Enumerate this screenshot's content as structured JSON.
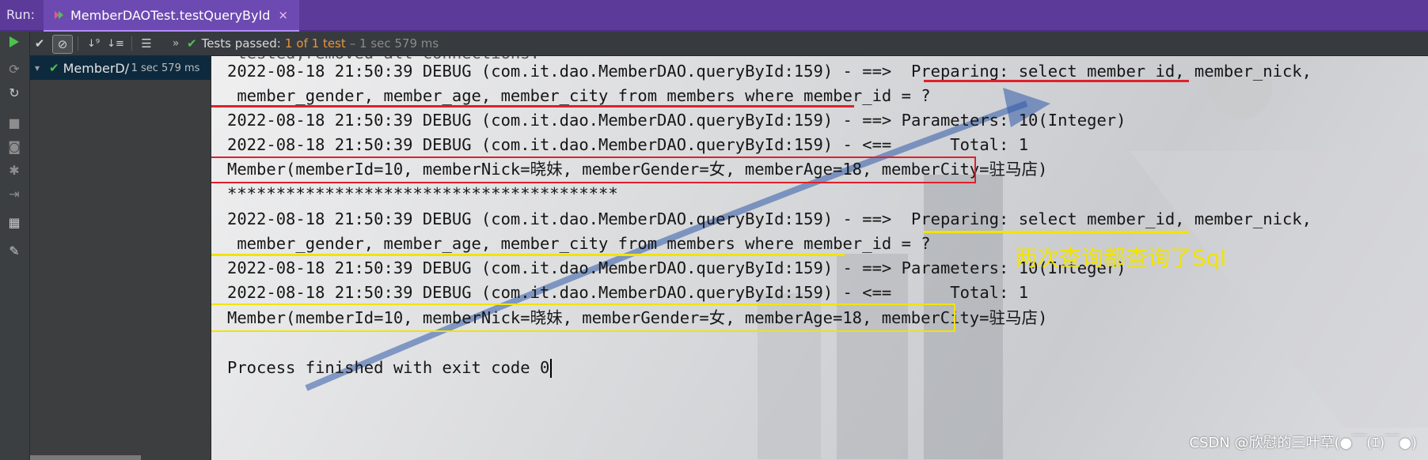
{
  "titlebar": {
    "run_label": "Run:",
    "tab_label": "MemberDAOTest.testQueryById",
    "tab_close": "×"
  },
  "toolbar": {
    "status_prefix": "Tests passed:",
    "status_count": "1",
    "status_total": "of 1 test",
    "status_time": "– 1 sec 579 ms",
    "more": "»"
  },
  "tree": {
    "item_name": "MemberD/",
    "item_time": "1 sec 579 ms"
  },
  "console": {
    "lines": [
      " tested,removed all connections.",
      "2022-08-18 21:50:39 DEBUG (com.it.dao.MemberDAO.queryById:159) - ==>  Preparing: select member_id, member_nick,",
      " member_gender, member_age, member_city from members where member_id = ?",
      "2022-08-18 21:50:39 DEBUG (com.it.dao.MemberDAO.queryById:159) - ==> Parameters: 10(Integer)",
      "2022-08-18 21:50:39 DEBUG (com.it.dao.MemberDAO.queryById:159) - <==      Total: 1",
      "Member(memberId=10, memberNick=晓妹, memberGender=女, memberAge=18, memberCity=驻马店)",
      "****************************************",
      "2022-08-18 21:50:39 DEBUG (com.it.dao.MemberDAO.queryById:159) - ==>  Preparing: select member_id, member_nick,",
      " member_gender, member_age, member_city from members where member_id = ?",
      "2022-08-18 21:50:39 DEBUG (com.it.dao.MemberDAO.queryById:159) - ==> Parameters: 10(Integer)",
      "2022-08-18 21:50:39 DEBUG (com.it.dao.MemberDAO.queryById:159) - <==      Total: 1",
      "Member(memberId=10, memberNick=晓妹, memberGender=女, memberAge=18, memberCity=驻马店)",
      "",
      "Process finished with exit code 0"
    ],
    "annotation": "两次查询都查询了Sql",
    "watermark": "CSDN @欣慰的三叶草(●￣(ｴ)￣●)"
  },
  "colors": {
    "titlebar": "#5b3a9a",
    "pass_green": "#4ec24e",
    "highlight_red": "#e0202a",
    "highlight_yellow": "#f2e400",
    "status_orange": "#e6973c"
  },
  "icons": {
    "gutter": [
      "run-icon",
      "rerun-failed-icon",
      "toggle-auto-test-icon",
      "stop-icon",
      "camera-icon",
      "settings-icon",
      "exit-icon",
      "layout-icon",
      "pin-icon"
    ],
    "toolbar": [
      "show-passed-icon",
      "show-ignored-icon",
      "sort-alpha-icon",
      "sort-duration-icon",
      "expand-all-icon"
    ]
  }
}
